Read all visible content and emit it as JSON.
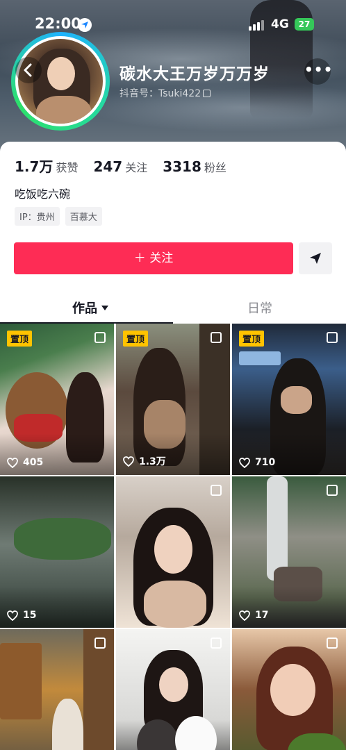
{
  "status_bar": {
    "time": "22:00",
    "network": "4G",
    "battery": "27"
  },
  "profile": {
    "username": "碳水大王万岁万万岁",
    "douyin_id": "抖音号：Tsuki422",
    "stats": [
      {
        "value": "1.7万",
        "label": "获赞"
      },
      {
        "value": "247",
        "label": "关注"
      },
      {
        "value": "3318",
        "label": "粉丝"
      }
    ],
    "bio": "吃饭吃六碗",
    "tags": [
      "IP：贵州",
      "百慕大"
    ]
  },
  "actions": {
    "follow_label": "＋ 关注"
  },
  "tabs": {
    "works": "作品",
    "daily": "日常"
  },
  "pin_label": "置顶",
  "videos": [
    {
      "pinned": true,
      "likes": "405"
    },
    {
      "pinned": true,
      "likes": "1.3万"
    },
    {
      "pinned": true,
      "likes": "710"
    },
    {
      "pinned": false,
      "likes": "15"
    },
    {
      "pinned": false,
      "likes": ""
    },
    {
      "pinned": false,
      "likes": "17"
    },
    {
      "pinned": false,
      "likes": ""
    },
    {
      "pinned": false,
      "likes": ""
    },
    {
      "pinned": false,
      "likes": ""
    }
  ],
  "colors": {
    "accent": "#fe2c55",
    "pin": "#ffc300"
  }
}
